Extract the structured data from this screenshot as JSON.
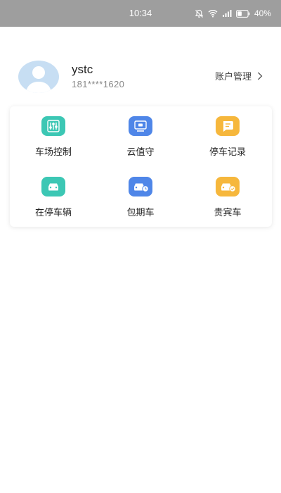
{
  "status_bar": {
    "time": "10:34",
    "battery": "40%",
    "icons": [
      "mute-bell-icon",
      "wifi-icon",
      "signal-icon",
      "battery-icon"
    ]
  },
  "profile": {
    "username": "ystc",
    "phone": "181****1620",
    "account_link": "账户管理"
  },
  "menu": {
    "items": [
      {
        "label": "车场控制",
        "icon": "sliders-icon",
        "color": "#3cc7b4"
      },
      {
        "label": "云值守",
        "icon": "monitor-icon",
        "color": "#4f86e8"
      },
      {
        "label": "停车记录",
        "icon": "record-icon",
        "color": "#f6b73c"
      },
      {
        "label": "在停车辆",
        "icon": "car-icon",
        "color": "#3cc7b4"
      },
      {
        "label": "包期车",
        "icon": "car-clock-icon",
        "color": "#4f86e8"
      },
      {
        "label": "贵宾车",
        "icon": "car-check-icon",
        "color": "#f6b73c"
      }
    ]
  },
  "colors": {
    "status_bar_bg": "#9e9e9e",
    "avatar_bg": "#c7def3",
    "teal": "#3cc7b4",
    "blue": "#4f86e8",
    "orange": "#f6b73c"
  }
}
